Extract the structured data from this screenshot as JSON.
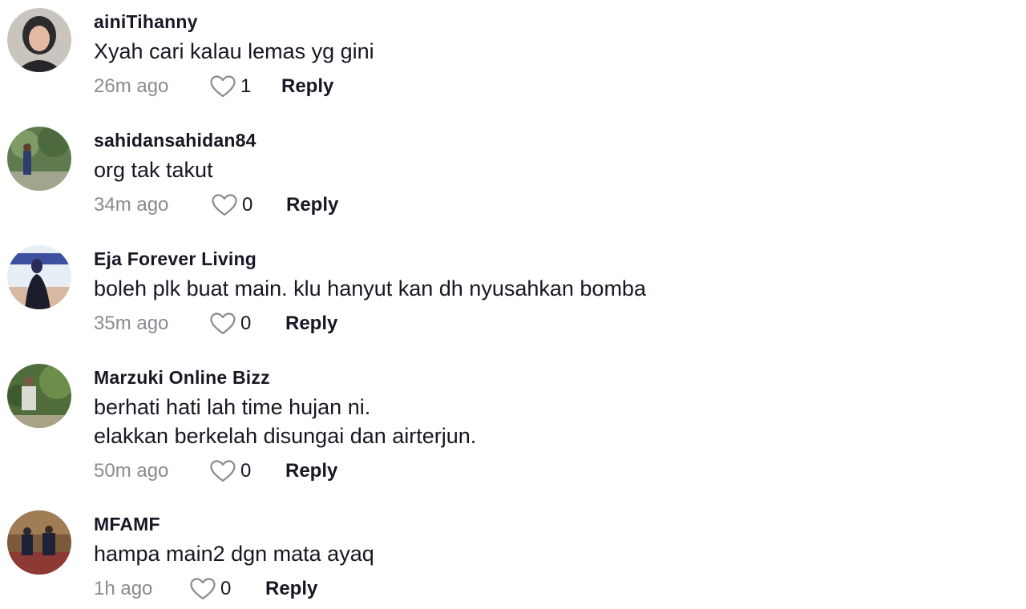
{
  "comments": [
    {
      "username": "ainiTihanny",
      "text": [
        "Xyah cari kalau lemas yg gini"
      ],
      "time": "26m ago",
      "likes": "1",
      "reply_label": "Reply",
      "avatar_icon": "avatar-photo"
    },
    {
      "username": "sahidansahidan84",
      "text": [
        "org tak takut"
      ],
      "time": "34m ago",
      "likes": "0",
      "reply_label": "Reply",
      "avatar_icon": "avatar-photo"
    },
    {
      "username": "Eja Forever Living",
      "text": [
        "boleh plk buat main. klu hanyut kan dh nyusahkan bomba"
      ],
      "time": "35m ago",
      "likes": "0",
      "reply_label": "Reply",
      "avatar_icon": "avatar-photo"
    },
    {
      "username": "Marzuki Online Bizz",
      "text": [
        "berhati hati lah time hujan ni.",
        "elakkan berkelah disungai dan airterjun."
      ],
      "time": "50m ago",
      "likes": "0",
      "reply_label": "Reply",
      "avatar_icon": "avatar-photo"
    },
    {
      "username": "MFAMF",
      "text": [
        "hampa main2 dgn mata ayaq"
      ],
      "time": "1h ago",
      "likes": "0",
      "reply_label": "Reply",
      "avatar_icon": "avatar-photo"
    }
  ],
  "colors": {
    "text_primary": "#161823",
    "text_secondary": "#8a8b91",
    "heart_outline": "#8a8b91"
  }
}
